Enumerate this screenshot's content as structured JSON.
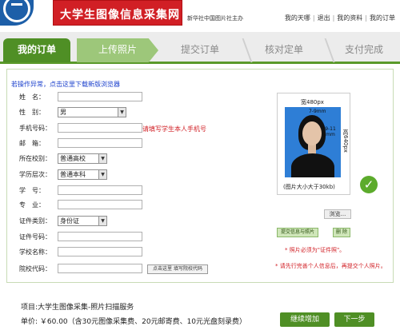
{
  "header": {
    "brand": "大学生图像信息采集网",
    "org": "新华社中国图片社主办",
    "links": [
      "我的天哪",
      "退出",
      "我的资料",
      "我的订单"
    ]
  },
  "steps": [
    "我的订单",
    "上传照片",
    "提交订单",
    "核对定单",
    "支付完成"
  ],
  "form": {
    "warn_link": "若操作异常，点击这里下载新版浏览器",
    "fields": [
      {
        "label": "姓　名：",
        "value": ""
      },
      {
        "label": "性　别：",
        "value": "男"
      },
      {
        "label": "手机号码：",
        "value": ""
      },
      {
        "label": "邮　箱：",
        "value": ""
      },
      {
        "label": "所在校别：",
        "value": "普通高校"
      },
      {
        "label": "学历层次：",
        "value": "普通本科"
      },
      {
        "label": "学　号：",
        "value": ""
      },
      {
        "label": "专　业：",
        "value": ""
      },
      {
        "label": "证件类别：",
        "value": "身份证"
      },
      {
        "label": "证件号码：",
        "value": ""
      },
      {
        "label": "学校名称：",
        "value": ""
      },
      {
        "label": "院校代码：",
        "value": ""
      }
    ],
    "phone_hint": "请填写学生本人手机号",
    "school_code_button": "点击这里 填写院校代码"
  },
  "photo": {
    "width_label": "宽480px",
    "top_margin": "7-9mm",
    "head_size": "9-11 mm",
    "height_label": "高640px",
    "size_note": "(图片大小大于30kb)",
    "browse": "浏览...",
    "submit_button": "提交信息与照片",
    "delete_button": "删 除",
    "note1": "* 照片必须为\"证件照\"。",
    "note2": "* 请先行完善个人信息后，再提交个人照片。"
  },
  "footer": {
    "project": "项目:大学生图像采集-照片扫描服务",
    "price": "单价: ￥60.00（含30元图像采集费、20元邮寄费、10元光盘刻录费）",
    "continue_button": "继续增加",
    "next_button": "下一步"
  },
  "colors": {
    "brand_red": "#d11f25",
    "step_green": "#4f8f25",
    "logo_blue": "#1d5fa8"
  }
}
